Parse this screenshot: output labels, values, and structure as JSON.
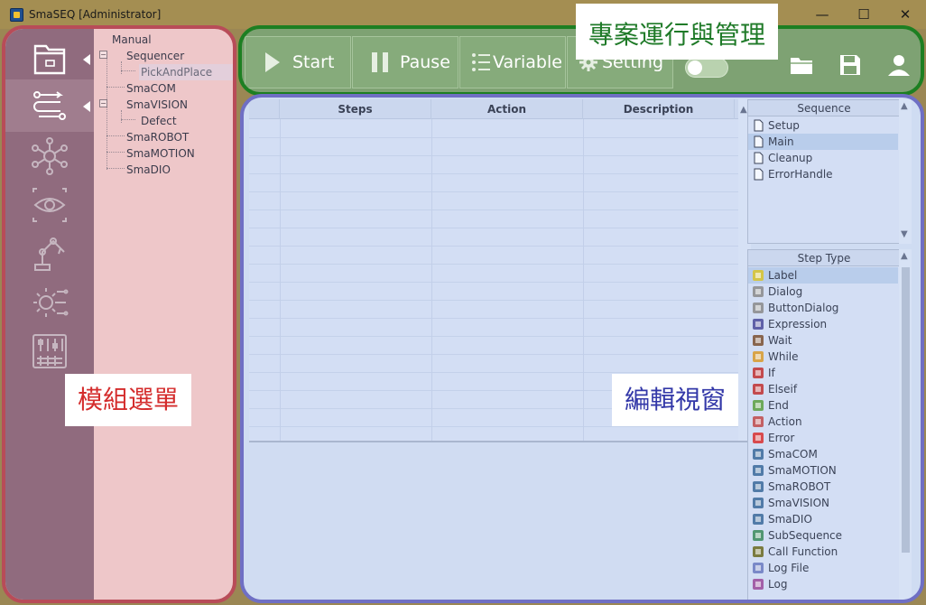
{
  "window": {
    "title": "SmaSEQ  [Administrator]",
    "minimize": "—",
    "maximize": "☐",
    "close": "✕"
  },
  "overlays": {
    "sidebar_label": "模組選單",
    "header_label": "專案運行與管理",
    "editor_label": "編輯視窗"
  },
  "sidebar": {
    "rail_icons": [
      "folder-icon",
      "sequence-flow-icon",
      "network-hub-icon",
      "vision-eye-icon",
      "robot-arm-icon",
      "gear-circuit-icon",
      "io-board-icon"
    ],
    "active_rail": "sequence-flow-icon",
    "tree": [
      "Manual",
      "Sequencer",
      "PickAndPlace",
      "SmaCOM",
      "SmaVISION",
      "Defect",
      "SmaROBOT",
      "SmaMOTION",
      "SmaDIO"
    ],
    "selected_tree": "PickAndPlace"
  },
  "toolbar": {
    "start_label": "Start",
    "pause_label": "Pause",
    "variable_label": "Variable",
    "setting_label": "Setting"
  },
  "grid": {
    "columns": [
      "Steps",
      "Action",
      "Description"
    ]
  },
  "sequence": {
    "header": "Sequence",
    "items": [
      "Setup",
      "Main",
      "Cleanup",
      "ErrorHandle"
    ],
    "selected": "Main"
  },
  "step_type": {
    "header": "Step Type",
    "items": [
      "Label",
      "Dialog",
      "ButtonDialog",
      "Expression",
      "Wait",
      "While",
      "If",
      "Elseif",
      "End",
      "Action",
      "Error",
      "SmaCOM",
      "SmaMOTION",
      "SmaROBOT",
      "SmaVISION",
      "SmaDIO",
      "SubSequence",
      "Call Function",
      "Log File",
      "Log"
    ],
    "selected": "Label"
  },
  "colors": {
    "sidebar_border": "#b84c58",
    "header_border": "#1d7f22",
    "editor_border": "#6f6fc4"
  }
}
